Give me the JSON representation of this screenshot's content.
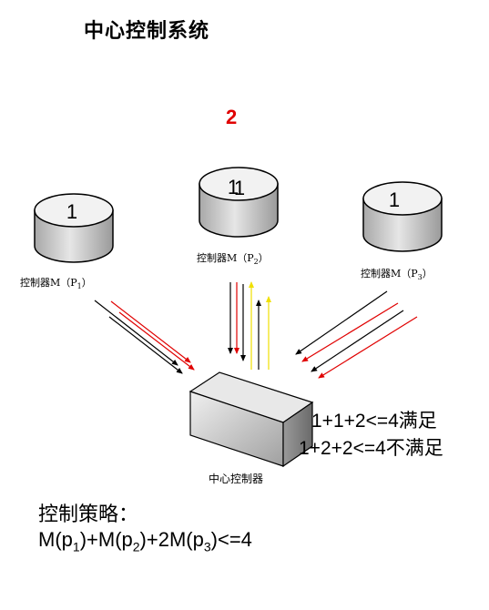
{
  "title": "中心控制系统",
  "red_number": "2",
  "controllers": [
    {
      "count": "1",
      "label_prefix": "控制器M（P",
      "label_sub": "1",
      "label_suffix": "）"
    },
    {
      "count": "1",
      "count_overlay": "1",
      "label_prefix": "控制器M（P",
      "label_sub": "2",
      "label_suffix": "）"
    },
    {
      "count": "1",
      "label_prefix": "控制器M（P",
      "label_sub": "3",
      "label_suffix": "）"
    }
  ],
  "central_label": "中心控制器",
  "checks": [
    "1+1+2<=4满足",
    "1+2+2<=4不满足"
  ],
  "strategy": {
    "title": "控制策略：",
    "formula": {
      "m1_prefix": "M(p",
      "m1_sub": "1",
      "m1_suffix": ")+M(p",
      "m2_sub": "2",
      "m2_suffix": ")+2M(p",
      "m3_sub": "3",
      "m3_suffix": ")<=4"
    }
  },
  "colors": {
    "accent_red": "#e00000",
    "arrow_black": "#000000",
    "arrow_red": "#e00000",
    "arrow_yellow": "#f0e000",
    "box_gray": "#c8c8c8"
  }
}
